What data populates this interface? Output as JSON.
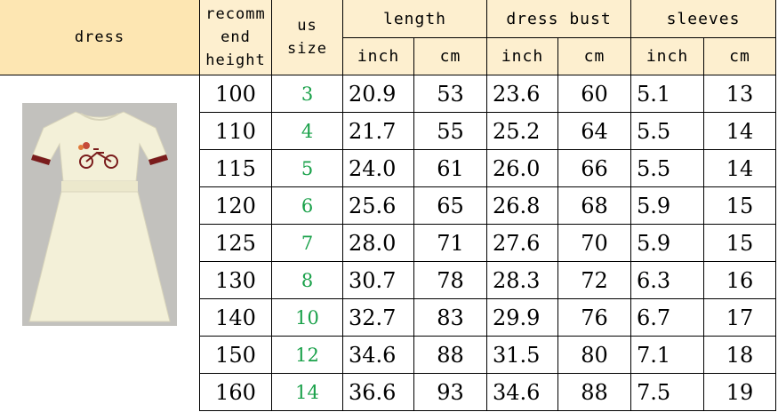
{
  "headers": {
    "dress": "dress",
    "height_line1": "recomm",
    "height_line2": "end",
    "height_line3": "height",
    "us_line1": "us",
    "us_line2": "size",
    "length": "length",
    "bust": "dress bust",
    "sleeves": "sleeves",
    "inch": "inch",
    "cm": "cm"
  },
  "rows": [
    {
      "height": "100",
      "us": "3",
      "len_in": "20.9",
      "len_cm": "53",
      "bust_in": "23.6",
      "bust_cm": "60",
      "sl_in": "5.1",
      "sl_cm": "13"
    },
    {
      "height": "110",
      "us": "4",
      "len_in": "21.7",
      "len_cm": "55",
      "bust_in": "25.2",
      "bust_cm": "64",
      "sl_in": "5.5",
      "sl_cm": "14"
    },
    {
      "height": "115",
      "us": "5",
      "len_in": "24.0",
      "len_cm": "61",
      "bust_in": "26.0",
      "bust_cm": "66",
      "sl_in": "5.5",
      "sl_cm": "14"
    },
    {
      "height": "120",
      "us": "6",
      "len_in": "25.6",
      "len_cm": "65",
      "bust_in": "26.8",
      "bust_cm": "68",
      "sl_in": "5.9",
      "sl_cm": "15"
    },
    {
      "height": "125",
      "us": "7",
      "len_in": "28.0",
      "len_cm": "71",
      "bust_in": "27.6",
      "bust_cm": "70",
      "sl_in": "5.9",
      "sl_cm": "15"
    },
    {
      "height": "130",
      "us": "8",
      "len_in": "30.7",
      "len_cm": "78",
      "bust_in": "28.3",
      "bust_cm": "72",
      "sl_in": "6.3",
      "sl_cm": "16"
    },
    {
      "height": "140",
      "us": "10",
      "len_in": "32.7",
      "len_cm": "83",
      "bust_in": "29.9",
      "bust_cm": "76",
      "sl_in": "6.7",
      "sl_cm": "17"
    },
    {
      "height": "150",
      "us": "12",
      "len_in": "34.6",
      "len_cm": "88",
      "bust_in": "31.5",
      "bust_cm": "80",
      "sl_in": "7.1",
      "sl_cm": "18"
    },
    {
      "height": "160",
      "us": "14",
      "len_in": "36.6",
      "len_cm": "93",
      "bust_in": "34.6",
      "bust_cm": "88",
      "sl_in": "7.5",
      "sl_cm": "19"
    }
  ],
  "colors": {
    "header_bg": "#fdefcf",
    "dress_header_bg": "#fde6b2",
    "us_size_text": "#1aa14a",
    "dress_fabric": "#f3f0d8",
    "sleeve_trim": "#7a1c1c",
    "photo_bg": "#bdbdb9"
  },
  "icons": {
    "dress_image": "dress-photo-icon"
  }
}
